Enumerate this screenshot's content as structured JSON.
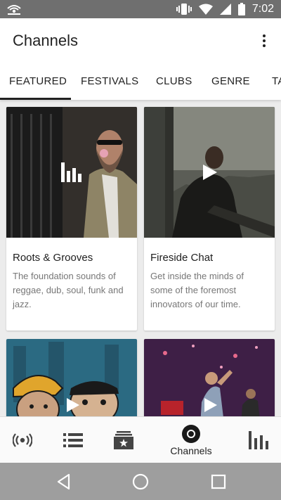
{
  "status_bar": {
    "time": "7:02"
  },
  "app_bar": {
    "title": "Channels"
  },
  "tabs": [
    {
      "label": "FEATURED",
      "active": true
    },
    {
      "label": "FESTIVALS",
      "active": false
    },
    {
      "label": "CLUBS",
      "active": false
    },
    {
      "label": "GENRE",
      "active": false
    },
    {
      "label": "TA",
      "active": false
    }
  ],
  "cards": [
    {
      "title": "Roots & Grooves",
      "description": "The foundation sounds of reggae, dub, soul, funk and jazz.",
      "overlay_icon": "equalizer-icon"
    },
    {
      "title": "Fireside Chat",
      "description": "Get inside the minds of some of the foremost innovators of our time.",
      "overlay_icon": "play-icon"
    },
    {
      "title": "",
      "description": "",
      "overlay_icon": "play-icon"
    },
    {
      "title": "",
      "description": "",
      "overlay_icon": "play-icon"
    }
  ],
  "bottom_nav": {
    "items": [
      {
        "icon": "live-radio-icon"
      },
      {
        "icon": "list-icon"
      },
      {
        "icon": "library-icon"
      },
      {
        "icon": "channels-icon",
        "label": "Channels",
        "active": true
      },
      {
        "icon": "equalizer-icon"
      }
    ]
  },
  "colors": {
    "status_bar": "#6f6f6f",
    "system_nav": "#9e9e9e",
    "background": "#ececec",
    "text_primary": "#222222",
    "text_secondary": "#777777"
  }
}
